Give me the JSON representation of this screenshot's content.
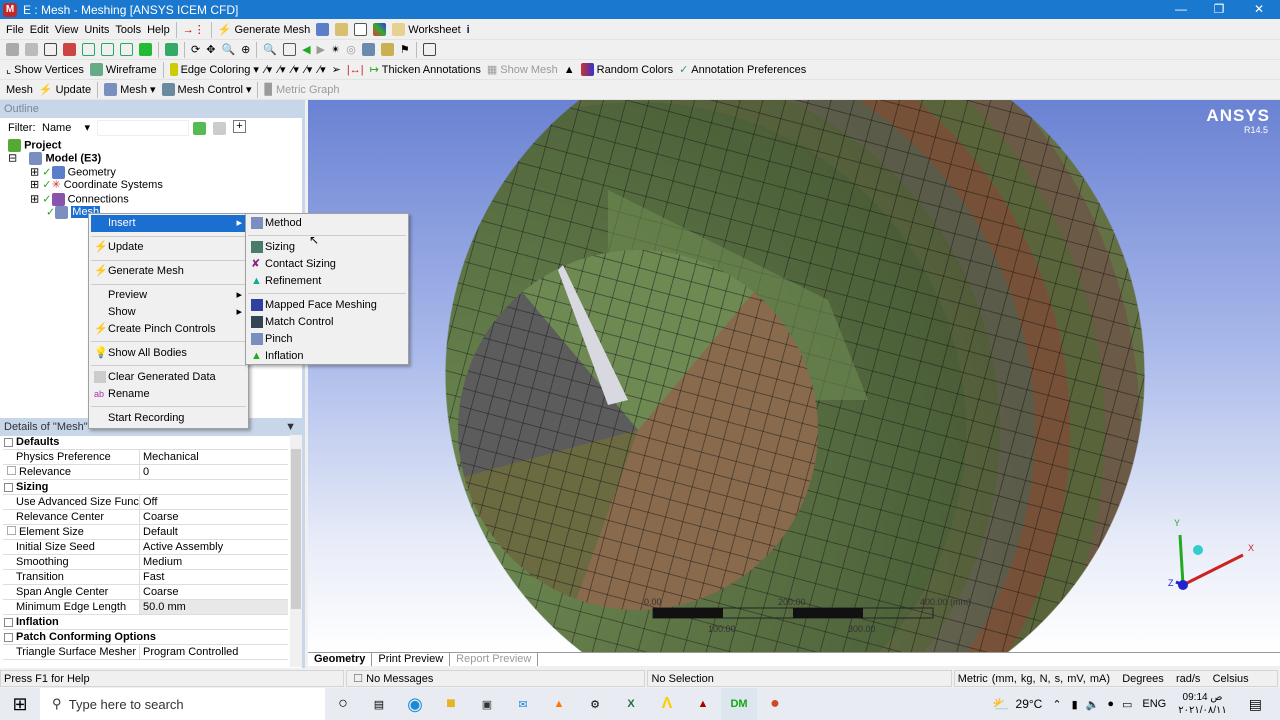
{
  "window": {
    "title": "E : Mesh - Meshing [ANSYS ICEM CFD]",
    "logo": "M"
  },
  "menubar": [
    "File",
    "Edit",
    "View",
    "Units",
    "Tools",
    "Help"
  ],
  "toolbar1": {
    "generate_mesh": "Generate Mesh",
    "worksheet": "Worksheet"
  },
  "toolbar3": {
    "show_vertices": "Show Vertices",
    "wireframe": "Wireframe",
    "edge_coloring": "Edge Coloring",
    "thicken": "Thicken Annotations",
    "show_mesh": "Show Mesh",
    "random_colors": "Random Colors",
    "annotation_prefs": "Annotation Preferences"
  },
  "toolbar4": {
    "mesh_label": "Mesh",
    "update": "Update",
    "mesh": "Mesh",
    "mesh_control": "Mesh Control",
    "metric_graph": "Metric Graph"
  },
  "outline": {
    "title": "Outline",
    "filter_label": "Filter:",
    "filter_value": "Name",
    "tree": {
      "project": "Project",
      "model": "Model (E3)",
      "geometry": "Geometry",
      "coord": "Coordinate Systems",
      "connections": "Connections",
      "mesh": "Mesh"
    }
  },
  "context_menu": {
    "insert": "Insert",
    "update": "Update",
    "generate_mesh": "Generate Mesh",
    "preview": "Preview",
    "show": "Show",
    "pinch": "Create Pinch Controls",
    "show_all": "Show All Bodies",
    "clear": "Clear Generated Data",
    "rename": "Rename",
    "record": "Start Recording"
  },
  "submenu": {
    "method": "Method",
    "sizing": "Sizing",
    "contact_sizing": "Contact Sizing",
    "refinement": "Refinement",
    "mapped": "Mapped Face Meshing",
    "match": "Match Control",
    "pinch": "Pinch",
    "inflation": "Inflation"
  },
  "details": {
    "title": "Details of \"Mesh\"",
    "rows": [
      {
        "group": "Defaults"
      },
      {
        "k": "Physics Preference",
        "v": "Mechanical"
      },
      {
        "k": "Relevance",
        "v": "0",
        "check": true
      },
      {
        "group": "Sizing"
      },
      {
        "k": "Use Advanced Size Function",
        "v": "Off"
      },
      {
        "k": "Relevance Center",
        "v": "Coarse"
      },
      {
        "k": "Element Size",
        "v": "Default",
        "check": true
      },
      {
        "k": "Initial Size Seed",
        "v": "Active Assembly"
      },
      {
        "k": "Smoothing",
        "v": "Medium"
      },
      {
        "k": "Transition",
        "v": "Fast"
      },
      {
        "k": "Span Angle Center",
        "v": "Coarse"
      },
      {
        "k": "Minimum Edge Length",
        "v": "50.0 mm"
      },
      {
        "group": "Inflation"
      },
      {
        "group": "Patch Conforming Options"
      },
      {
        "k": "Triangle Surface Mesher",
        "v": "Program Controlled"
      }
    ]
  },
  "viewport": {
    "brand": "ANSYS",
    "version": "R14.5",
    "scale": {
      "t0": "0.00",
      "t200": "200.00",
      "t400": "400.00 (mm)",
      "t100": "100.00",
      "t300": "300.00"
    },
    "axes": {
      "x": "X",
      "y": "Y",
      "z": "Z"
    }
  },
  "tabs": [
    "Geometry",
    "Print Preview",
    "Report Preview"
  ],
  "status": {
    "help": "Press F1 for Help",
    "messages": "No Messages",
    "selection": "No Selection",
    "units": "Metric (mm, kg, N, s, mV, mA)",
    "angle": "Degrees",
    "rot": "rad/s",
    "temp": "Celsius"
  },
  "taskbar": {
    "search": "Type here to search",
    "temp": "29°C",
    "lang": "ENG",
    "time": "09:14 ص",
    "date": "٢٠٢١/٠٨/١١"
  }
}
